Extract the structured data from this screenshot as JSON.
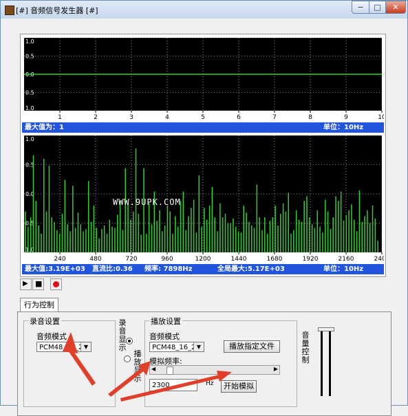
{
  "window": {
    "title": "[#] 音频信号发生器 [#]",
    "min_glyph": "−",
    "max_glyph": "□",
    "close_glyph": "✕"
  },
  "chart_data": [
    {
      "type": "line",
      "ylabels": [
        "1.0",
        "0.5",
        "0.0",
        "0.5",
        "1.0"
      ],
      "xticks": [
        "1",
        "2",
        "3",
        "4",
        "5",
        "6",
        "7",
        "8",
        "9",
        "10"
      ],
      "series": [
        {
          "values": [
            0,
            0,
            0,
            0,
            0,
            0,
            0,
            0,
            0,
            0
          ]
        }
      ],
      "xlim": [
        0,
        10
      ],
      "ylim": [
        -1,
        1
      ],
      "color": "#2fd22f"
    },
    {
      "type": "bar",
      "ylabels": [
        "1.0",
        "0.5",
        "0.0",
        "0.5",
        "1.0"
      ],
      "xticks": [
        "240",
        "480",
        "720",
        "960",
        "1200",
        "1440",
        "1680",
        "1920",
        "2160",
        "2400"
      ],
      "xlim": [
        0,
        2400
      ],
      "ylim": [
        -1,
        1
      ],
      "color": "#2fd22f",
      "values": [
        0.35,
        0.22,
        0.3,
        0.83,
        0.44,
        0.23,
        0.16,
        0.8,
        0.35,
        0.74,
        0.3,
        0.26,
        0.19,
        0.16,
        0.33,
        0.62,
        0.24,
        0.18,
        0.57,
        0.21,
        0.34,
        0.24,
        0.18,
        0.2,
        0.61,
        0.26,
        0.4,
        0.21,
        0.12,
        0.2,
        0.23,
        0.16,
        0.28,
        0.22,
        0.21,
        0.32,
        0.44,
        0.19,
        0.72,
        0.42,
        0.28,
        0.35,
        0.89,
        0.33,
        0.15,
        0.72,
        0.16,
        0.42,
        0.24,
        0.52,
        0.27,
        0.36,
        0.18,
        0.23,
        0.4,
        0.35,
        0.16,
        0.31,
        0.22,
        0.44,
        0.52,
        0.19,
        0.31,
        0.38,
        0.45,
        0.17,
        0.66,
        0.22,
        0.38,
        0.28,
        0.4,
        0.56,
        0.3,
        0.18,
        0.42,
        0.3,
        0.33,
        0.25,
        0.25,
        0.29,
        0.22,
        0.18,
        0.17,
        0.4,
        0.34,
        0.26,
        0.23,
        0.21,
        0.58,
        0.3,
        0.19,
        0.3,
        0.16,
        0.27,
        0.3,
        0.4,
        0.23,
        0.33,
        0.42,
        0.35,
        0.51,
        0.16,
        0.19,
        0.36,
        0.28,
        0.26,
        0.44,
        0.48,
        0.3,
        0.24,
        0.21,
        0.36,
        0.22,
        0.17,
        0.45,
        0.35,
        0.2,
        0.3,
        0.48,
        0.44,
        0.52,
        0.27,
        0.32,
        0.36,
        0.41,
        0.28,
        0.18,
        0.53,
        0.26,
        0.31,
        0.36,
        0.25,
        0.4,
        0.29,
        0.1
      ]
    }
  ],
  "top_status": {
    "left": "最大值为：1",
    "right": "单位：10Hz"
  },
  "bottom_status": {
    "max": "最大值:3.19E+03",
    "dc": "直流比:0.36",
    "freq": "频率: 7898Hz",
    "global": "全局最大:5.17E+03",
    "unit": "单位：10Hz"
  },
  "watermark": "WWW.9UPK.COM",
  "toolbar": {
    "play_glyph": "▶",
    "stop_glyph": "■",
    "record_color": "#e01010"
  },
  "tab": {
    "label": "行为控制"
  },
  "record": {
    "group_title": "录音设置",
    "mode_label": "音频模式",
    "mode_value": "PCM48_16_2"
  },
  "display": {
    "record_display": "录音显示",
    "play_display": "播放显示"
  },
  "play": {
    "group_title": "播放设置",
    "mode_label": "音频模式",
    "mode_value": "PCM48_16_2",
    "file_button": "播放指定文件",
    "sim_freq_label": "模拟频率:",
    "freq_value": "2300",
    "hz_unit": "Hz",
    "start_button": "开始模拟"
  },
  "volume": {
    "label": "音量控制"
  }
}
